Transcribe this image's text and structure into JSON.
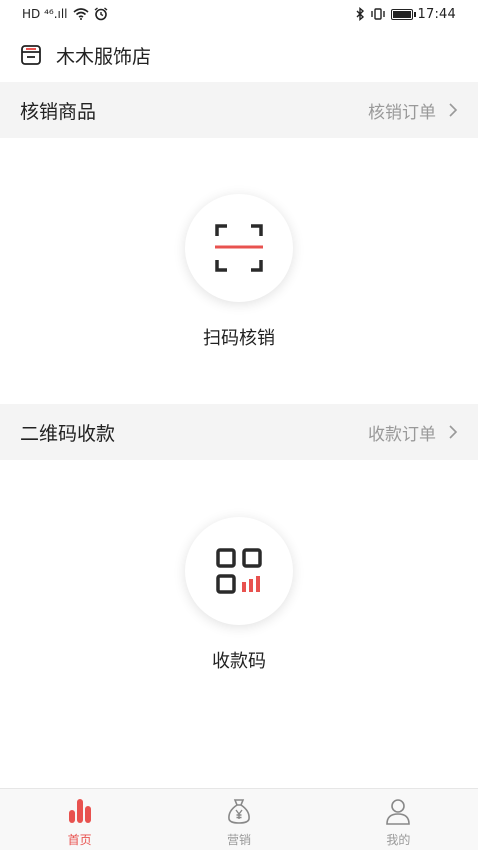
{
  "status_bar": {
    "left_indicators": "HD ⁴⁶.ıll",
    "time": "17:44"
  },
  "header": {
    "store_name": "木木服饰店",
    "store_icon": "storefront-icon"
  },
  "verify_section": {
    "title": "核销商品",
    "link_label": "核销订单",
    "action_label": "扫码核销",
    "action_icon": "scan-icon"
  },
  "qr_section": {
    "title": "二维码收款",
    "link_label": "收款订单",
    "action_label": "收款码",
    "action_icon": "qr-code-icon"
  },
  "bottom_nav": {
    "items": [
      {
        "label": "首页",
        "icon": "bar-chart-icon",
        "active": true
      },
      {
        "label": "营销",
        "icon": "money-bag-icon",
        "active": false
      },
      {
        "label": "我的",
        "icon": "user-icon",
        "active": false
      }
    ]
  },
  "colors": {
    "accent": "#e8524f",
    "section_bg": "#f4f4f4",
    "muted_text": "#999999"
  }
}
